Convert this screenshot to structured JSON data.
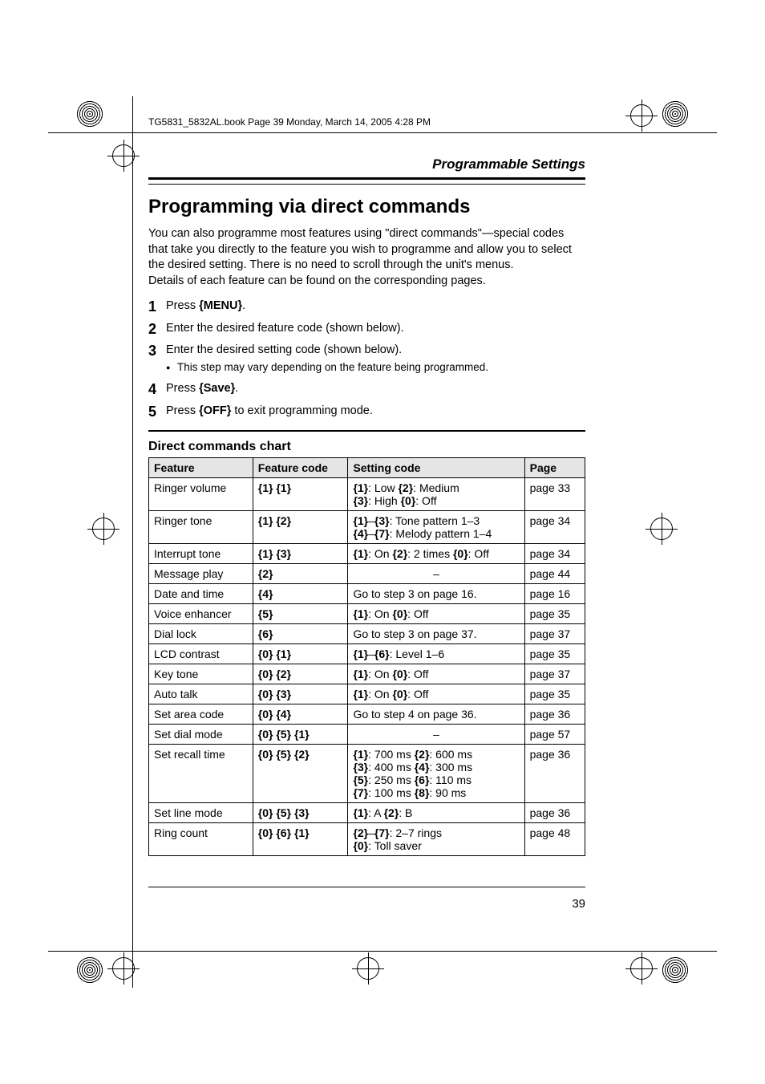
{
  "runhead": "TG5831_5832AL.book  Page 39  Monday, March 14, 2005  4:28 PM",
  "section_header": "Programmable Settings",
  "h1": "Programming via direct commands",
  "intro": "You can also programme most features using \"direct commands\"—special codes that take you directly to the feature you wish to programme and allow you to select the desired setting. There is no need to scroll through the unit's menus.\nDetails of each feature can be found on the corresponding pages.",
  "steps": [
    {
      "n": "1",
      "text_prefix": "Press ",
      "key": "MENU",
      "text_suffix": "."
    },
    {
      "n": "2",
      "text": "Enter the desired feature code (shown below)."
    },
    {
      "n": "3",
      "text": "Enter the desired setting code (shown below).",
      "sub": "This step may vary depending on the feature being programmed."
    },
    {
      "n": "4",
      "text_prefix": "Press ",
      "key": "Save",
      "text_suffix": "."
    },
    {
      "n": "5",
      "text_prefix": "Press ",
      "key": "OFF",
      "text_suffix": " to exit programming mode."
    }
  ],
  "h2": "Direct commands chart",
  "table_headers": [
    "Feature",
    "Feature code",
    "Setting code",
    "Page"
  ],
  "rows": [
    {
      "feature": "Ringer volume",
      "code": "{1} {1}",
      "setting": "{1}: Low {2}: Medium\n{3}: High {0}: Off",
      "page": "page 33"
    },
    {
      "feature": "Ringer tone",
      "code": "{1} {2}",
      "setting": "{1}–{3}: Tone pattern 1–3\n{4}–{7}: Melody pattern 1–4",
      "page": "page 34"
    },
    {
      "feature": "Interrupt tone",
      "code": "{1} {3}",
      "setting": "{1}: On {2}: 2 times {0}: Off",
      "page": "page 34"
    },
    {
      "feature": "Message play",
      "code": "{2}",
      "setting": "–",
      "center": true,
      "page": "page 44"
    },
    {
      "feature": "Date and time",
      "code": "{4}",
      "setting": "Go to step 3 on page 16.",
      "page": "page 16"
    },
    {
      "feature": "Voice enhancer",
      "code": "{5}",
      "setting": "{1}: On {0}: Off",
      "page": "page 35"
    },
    {
      "feature": "Dial lock",
      "code": "{6}",
      "setting": "Go to step 3 on page 37.",
      "page": "page 37"
    },
    {
      "feature": "LCD contrast",
      "code": "{0} {1}",
      "setting": "{1}–{6}: Level 1–6",
      "page": "page 35"
    },
    {
      "feature": "Key tone",
      "code": "{0} {2}",
      "setting": "{1}: On {0}: Off",
      "page": "page 37"
    },
    {
      "feature": "Auto talk",
      "code": "{0} {3}",
      "setting": "{1}: On {0}: Off",
      "page": "page 35"
    },
    {
      "feature": "Set area code",
      "code": "{0} {4}",
      "setting": "Go to step 4 on page 36.",
      "page": "page 36"
    },
    {
      "feature": "Set dial mode",
      "code": "{0} {5} {1}",
      "setting": "–",
      "center": true,
      "page": "page 57"
    },
    {
      "feature": "Set recall time",
      "code": "{0} {5} {2}",
      "setting": "{1}: 700 ms {2}: 600 ms\n{3}: 400 ms {4}: 300 ms\n{5}: 250 ms {6}: 110 ms\n{7}: 100 ms {8}:   90 ms",
      "page": "page 36"
    },
    {
      "feature": "Set line mode",
      "code": "{0} {5} {3}",
      "setting": "{1}: A {2}: B",
      "page": "page 36"
    },
    {
      "feature": "Ring count",
      "code": "{0} {6} {1}",
      "setting": "{2}–{7}: 2–7 rings\n{0}: Toll saver",
      "page": "page 48"
    }
  ],
  "page_number": "39"
}
